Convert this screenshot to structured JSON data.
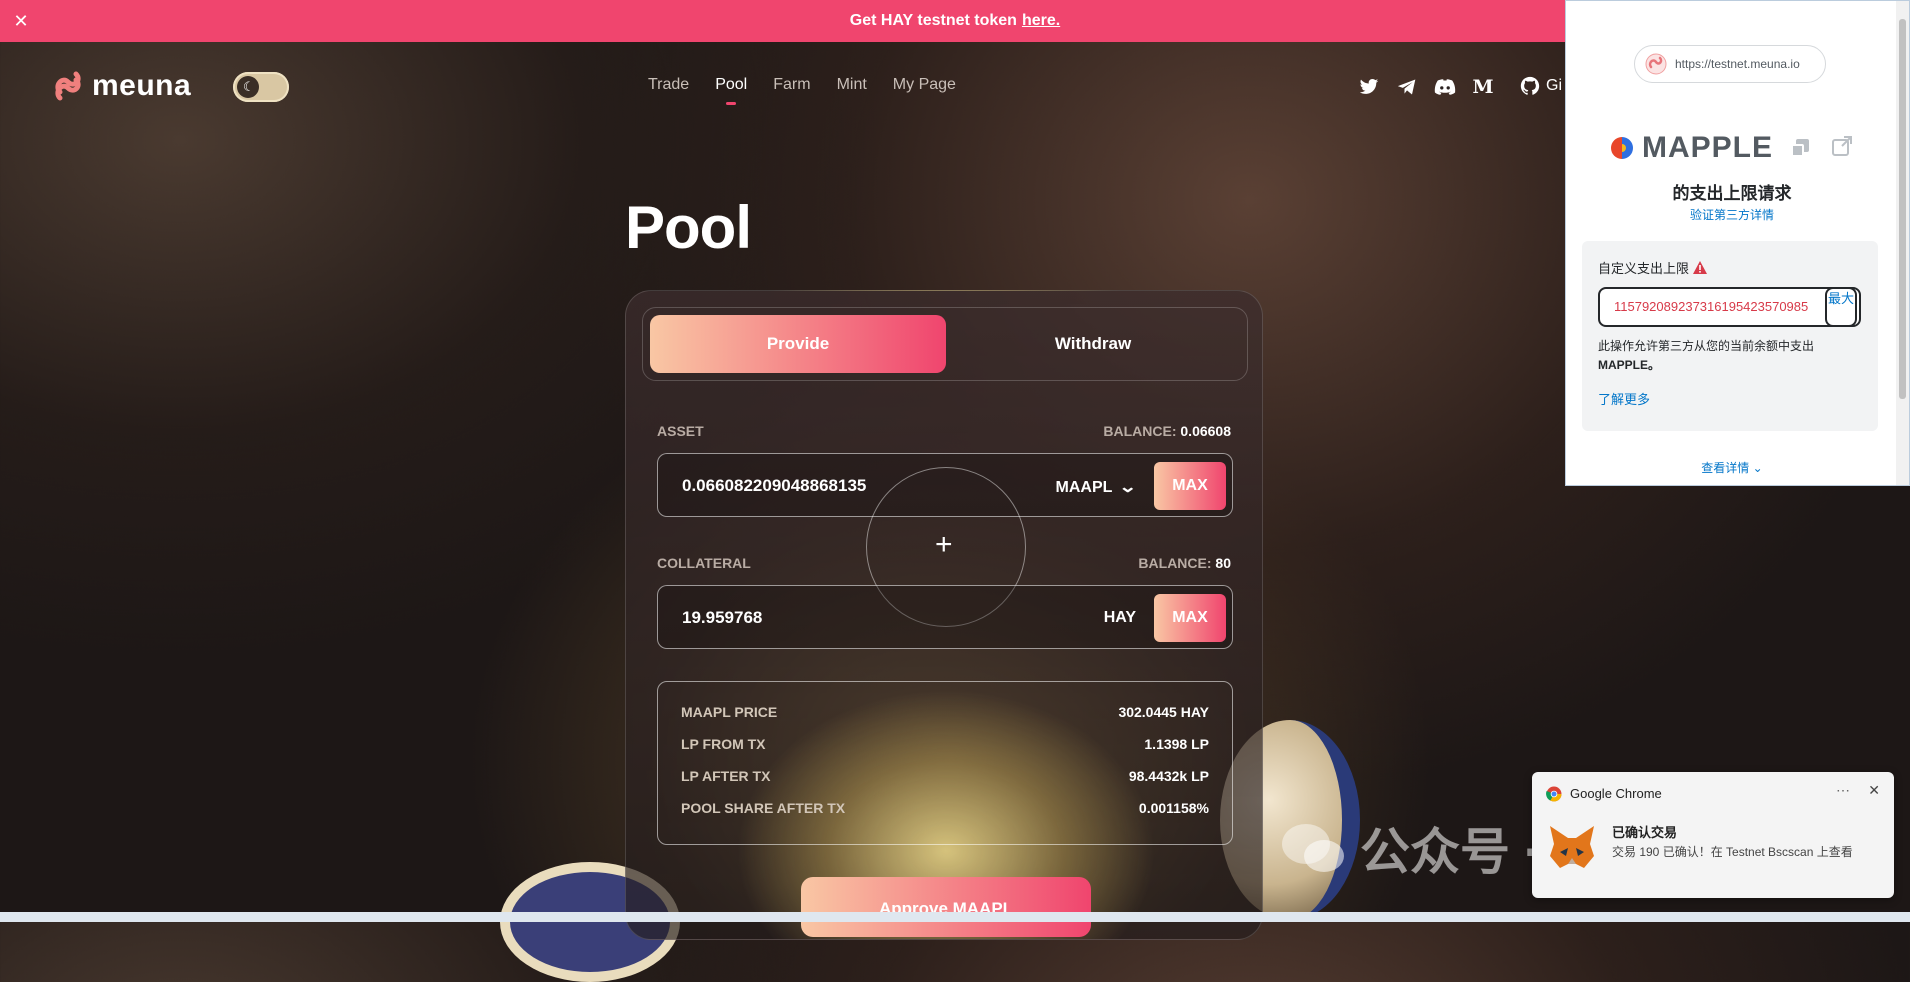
{
  "banner": {
    "text": "Get HAY testnet token",
    "link": "here.",
    "close_icon": "close-icon"
  },
  "brand": {
    "logo_text": "meuna",
    "logo_icon": "meuna-logo-icon"
  },
  "theme_toggle": {
    "icon": "moon-icon"
  },
  "nav": {
    "items": [
      "Trade",
      "Pool",
      "Farm",
      "Mint",
      "My Page"
    ],
    "active": "Pool"
  },
  "social": {
    "icons": [
      "twitter-icon",
      "telegram-icon",
      "discord-icon",
      "medium-icon"
    ],
    "github_label": "Gi"
  },
  "pool": {
    "title": "Pool",
    "tabs": {
      "provide": "Provide",
      "withdraw": "Withdraw",
      "active": "Provide"
    },
    "asset": {
      "label": "ASSET",
      "balance_label": "BALANCE:",
      "balance_value": "0.06608",
      "amount": "0.066082209048868135",
      "symbol": "MAAPL",
      "max": "MAX"
    },
    "plus": "+",
    "collateral": {
      "label": "COLLATERAL",
      "balance_label": "BALANCE:",
      "balance_value": "80",
      "amount": "19.959768",
      "symbol": "HAY",
      "max": "MAX"
    },
    "info": [
      {
        "key": "MAAPL PRICE",
        "value": "302.0445 HAY"
      },
      {
        "key": "LP FROM TX",
        "value": "1.1398 LP"
      },
      {
        "key": "LP AFTER TX",
        "value": "98.4432k LP"
      },
      {
        "key": "POOL SHARE AFTER TX",
        "value": "0.001158%"
      }
    ],
    "approve": "Approve MAAPL"
  },
  "metamask": {
    "site_url": "https://testnet.meuna.io",
    "token_name": "MAPPLE",
    "heading": "的支出上限请求",
    "verify_link": "验证第三方详情",
    "custom_limit_label": "自定义支出上限",
    "custom_limit_value": "115792089237316195423570985",
    "max_label": "最大",
    "note_line1": "此操作允许第三方从您的当前余额中支出",
    "note_token": "MAPPLE。",
    "learn_more": "了解更多",
    "view_details": "查看详情"
  },
  "notification": {
    "app": "Google Chrome",
    "title": "已确认交易",
    "body": "交易 190 已确认！在 Testnet Bscscan 上查看"
  },
  "watermark": {
    "text": "公众号 · 花花加密社"
  },
  "colors": {
    "accent": "#f0456e",
    "accent_light": "#f9c7a4",
    "link": "#0376c9"
  }
}
